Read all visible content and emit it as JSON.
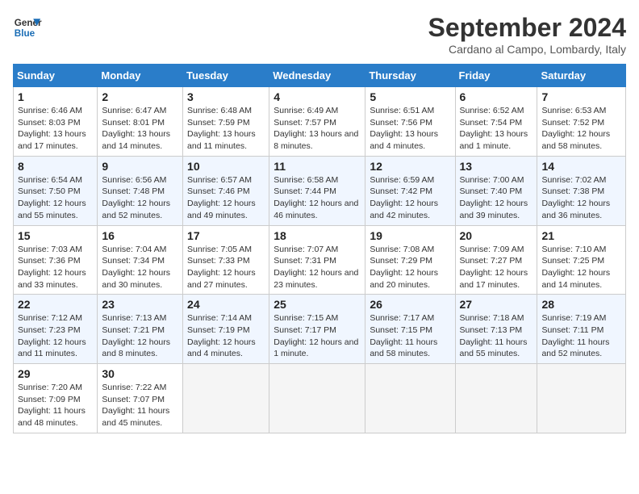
{
  "header": {
    "logo_line1": "General",
    "logo_line2": "Blue",
    "title": "September 2024",
    "subtitle": "Cardano al Campo, Lombardy, Italy"
  },
  "weekdays": [
    "Sunday",
    "Monday",
    "Tuesday",
    "Wednesday",
    "Thursday",
    "Friday",
    "Saturday"
  ],
  "weeks": [
    [
      {
        "day": "1",
        "sunrise": "6:46 AM",
        "sunset": "8:03 PM",
        "daylight": "13 hours and 17 minutes."
      },
      {
        "day": "2",
        "sunrise": "6:47 AM",
        "sunset": "8:01 PM",
        "daylight": "13 hours and 14 minutes."
      },
      {
        "day": "3",
        "sunrise": "6:48 AM",
        "sunset": "7:59 PM",
        "daylight": "13 hours and 11 minutes."
      },
      {
        "day": "4",
        "sunrise": "6:49 AM",
        "sunset": "7:57 PM",
        "daylight": "13 hours and 8 minutes."
      },
      {
        "day": "5",
        "sunrise": "6:51 AM",
        "sunset": "7:56 PM",
        "daylight": "13 hours and 4 minutes."
      },
      {
        "day": "6",
        "sunrise": "6:52 AM",
        "sunset": "7:54 PM",
        "daylight": "13 hours and 1 minute."
      },
      {
        "day": "7",
        "sunrise": "6:53 AM",
        "sunset": "7:52 PM",
        "daylight": "12 hours and 58 minutes."
      }
    ],
    [
      {
        "day": "8",
        "sunrise": "6:54 AM",
        "sunset": "7:50 PM",
        "daylight": "12 hours and 55 minutes."
      },
      {
        "day": "9",
        "sunrise": "6:56 AM",
        "sunset": "7:48 PM",
        "daylight": "12 hours and 52 minutes."
      },
      {
        "day": "10",
        "sunrise": "6:57 AM",
        "sunset": "7:46 PM",
        "daylight": "12 hours and 49 minutes."
      },
      {
        "day": "11",
        "sunrise": "6:58 AM",
        "sunset": "7:44 PM",
        "daylight": "12 hours and 46 minutes."
      },
      {
        "day": "12",
        "sunrise": "6:59 AM",
        "sunset": "7:42 PM",
        "daylight": "12 hours and 42 minutes."
      },
      {
        "day": "13",
        "sunrise": "7:00 AM",
        "sunset": "7:40 PM",
        "daylight": "12 hours and 39 minutes."
      },
      {
        "day": "14",
        "sunrise": "7:02 AM",
        "sunset": "7:38 PM",
        "daylight": "12 hours and 36 minutes."
      }
    ],
    [
      {
        "day": "15",
        "sunrise": "7:03 AM",
        "sunset": "7:36 PM",
        "daylight": "12 hours and 33 minutes."
      },
      {
        "day": "16",
        "sunrise": "7:04 AM",
        "sunset": "7:34 PM",
        "daylight": "12 hours and 30 minutes."
      },
      {
        "day": "17",
        "sunrise": "7:05 AM",
        "sunset": "7:33 PM",
        "daylight": "12 hours and 27 minutes."
      },
      {
        "day": "18",
        "sunrise": "7:07 AM",
        "sunset": "7:31 PM",
        "daylight": "12 hours and 23 minutes."
      },
      {
        "day": "19",
        "sunrise": "7:08 AM",
        "sunset": "7:29 PM",
        "daylight": "12 hours and 20 minutes."
      },
      {
        "day": "20",
        "sunrise": "7:09 AM",
        "sunset": "7:27 PM",
        "daylight": "12 hours and 17 minutes."
      },
      {
        "day": "21",
        "sunrise": "7:10 AM",
        "sunset": "7:25 PM",
        "daylight": "12 hours and 14 minutes."
      }
    ],
    [
      {
        "day": "22",
        "sunrise": "7:12 AM",
        "sunset": "7:23 PM",
        "daylight": "12 hours and 11 minutes."
      },
      {
        "day": "23",
        "sunrise": "7:13 AM",
        "sunset": "7:21 PM",
        "daylight": "12 hours and 8 minutes."
      },
      {
        "day": "24",
        "sunrise": "7:14 AM",
        "sunset": "7:19 PM",
        "daylight": "12 hours and 4 minutes."
      },
      {
        "day": "25",
        "sunrise": "7:15 AM",
        "sunset": "7:17 PM",
        "daylight": "12 hours and 1 minute."
      },
      {
        "day": "26",
        "sunrise": "7:17 AM",
        "sunset": "7:15 PM",
        "daylight": "11 hours and 58 minutes."
      },
      {
        "day": "27",
        "sunrise": "7:18 AM",
        "sunset": "7:13 PM",
        "daylight": "11 hours and 55 minutes."
      },
      {
        "day": "28",
        "sunrise": "7:19 AM",
        "sunset": "7:11 PM",
        "daylight": "11 hours and 52 minutes."
      }
    ],
    [
      {
        "day": "29",
        "sunrise": "7:20 AM",
        "sunset": "7:09 PM",
        "daylight": "11 hours and 48 minutes."
      },
      {
        "day": "30",
        "sunrise": "7:22 AM",
        "sunset": "7:07 PM",
        "daylight": "11 hours and 45 minutes."
      },
      null,
      null,
      null,
      null,
      null
    ]
  ]
}
